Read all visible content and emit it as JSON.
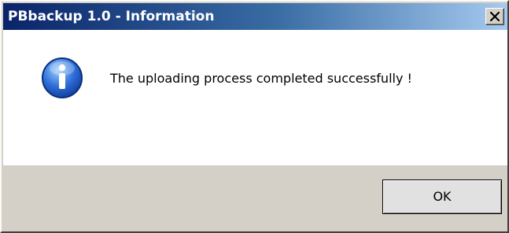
{
  "window": {
    "title": "PBbackup 1.0 - Information",
    "close_label": "close"
  },
  "message": {
    "icon": "info-icon",
    "text": "The uploading process completed successfully !"
  },
  "buttons": {
    "ok_label": "OK"
  },
  "colors": {
    "titlebar_start": "#0a246a",
    "titlebar_end": "#a6caf0",
    "dialog_background": "#d4d0c8",
    "content_background": "#ffffff"
  }
}
